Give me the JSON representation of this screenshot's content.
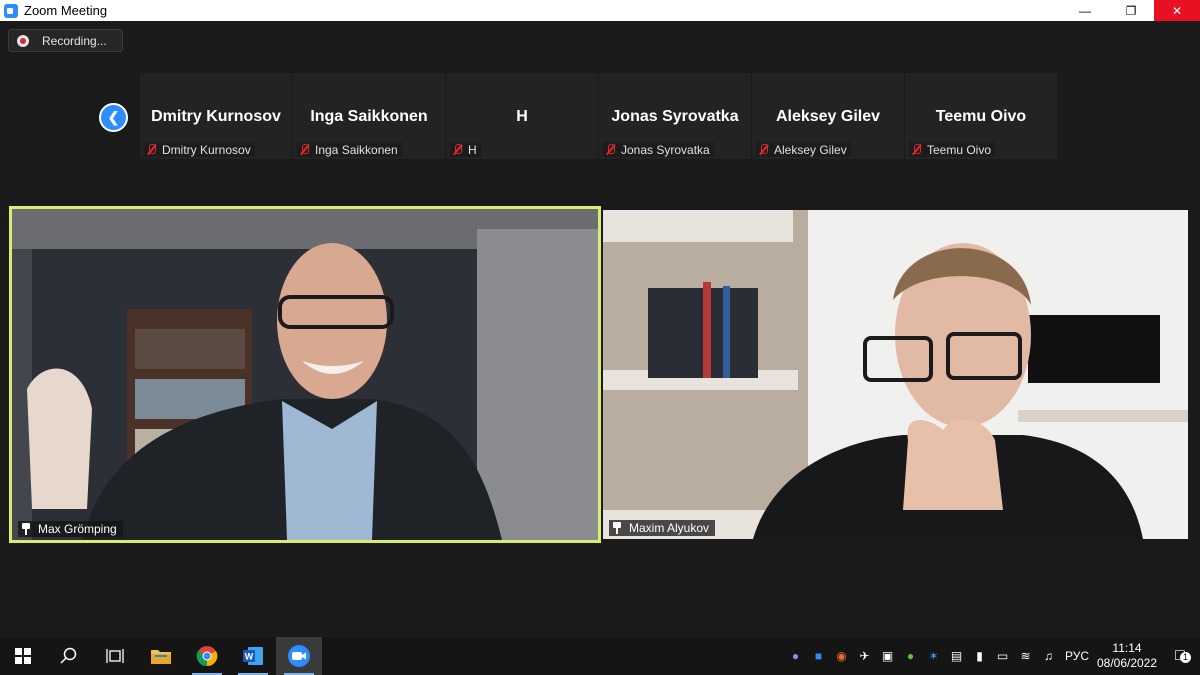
{
  "window": {
    "title": "Zoom Meeting",
    "minimize": "—",
    "restore": "❐",
    "close": "✕"
  },
  "recording": {
    "label": "Recording..."
  },
  "gallery": {
    "prev_icon": "chevron-left",
    "tiles": [
      {
        "name": "Dmitry Kurnosov",
        "label": "Dmitry Kurnosov"
      },
      {
        "name": "Inga Saikkonen",
        "label": "Inga Saikkonen"
      },
      {
        "name": "H",
        "label": "H"
      },
      {
        "name": "Jonas Syrovatka",
        "label": "Jonas Syrovatka"
      },
      {
        "name": "Aleksey Gilev",
        "label": "Aleksey Gilev"
      },
      {
        "name": "Teemu Oivo",
        "label": "Teemu Oivo"
      }
    ]
  },
  "videos": [
    {
      "name": "Max Grömping",
      "active_speaker": true
    },
    {
      "name": "Maxim Alyukov",
      "active_speaker": false
    }
  ],
  "taskbar": {
    "apps": [
      "start",
      "search",
      "task-view",
      "file-explorer",
      "chrome",
      "word",
      "zoom"
    ],
    "lang": "РУС",
    "time": "11:14",
    "date": "08/06/2022",
    "notifications": "1"
  },
  "colors": {
    "accent": "#2d8cff",
    "speaker_border": "#d8ee6a",
    "close": "#e81123",
    "mute": "#e02828"
  }
}
